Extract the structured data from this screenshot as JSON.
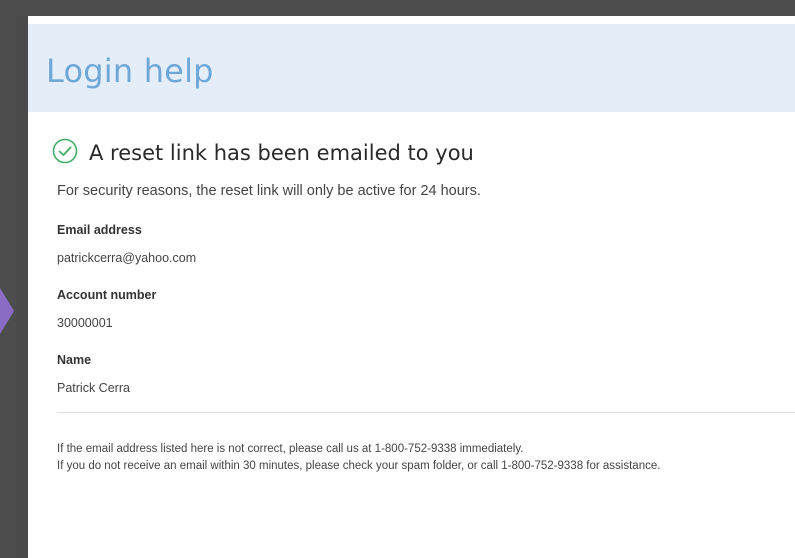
{
  "header": {
    "title": "Login help"
  },
  "confirmation": {
    "title": "A reset link has been emailed to you",
    "security_note": "For security reasons, the reset link will only be active for 24 hours."
  },
  "fields": [
    {
      "label": "Email address",
      "value": "patrickcerra@yahoo.com"
    },
    {
      "label": "Account number",
      "value": "30000001"
    },
    {
      "label": "Name",
      "value": "Patrick Cerra"
    }
  ],
  "footer": {
    "line1": "If the email address listed here is not correct, please call us at 1-800-752-9338 immediately.",
    "line2": "If you do not receive an email within 30 minutes, please check your spam folder, or call 1-800-752-9338 for assistance."
  },
  "colors": {
    "header_bg": "#e3eef8",
    "header_title": "#6fa8d8",
    "success_green": "#3fae63",
    "frame_gray": "#4d4d4d",
    "accent_purple": "#8a6cc4"
  },
  "icons": {
    "success": "check-circle-icon"
  }
}
